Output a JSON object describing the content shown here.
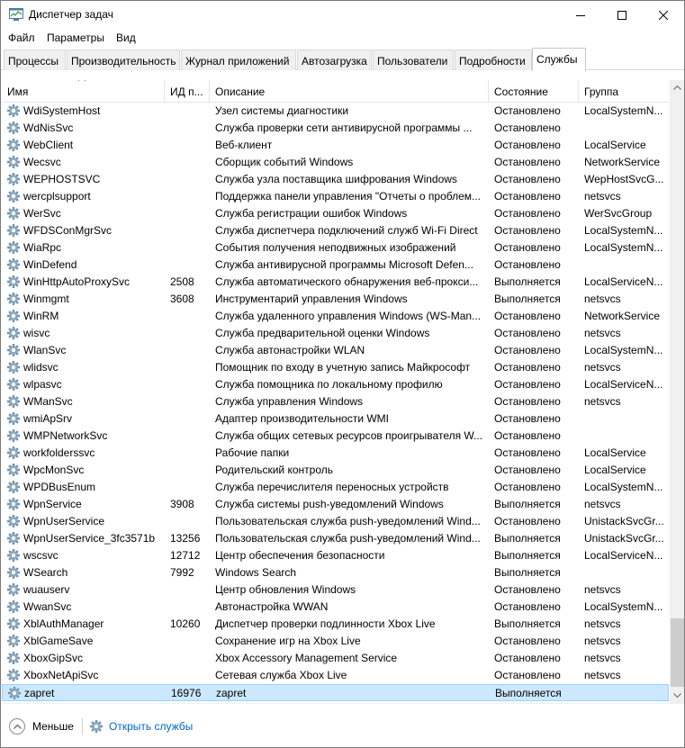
{
  "window": {
    "title": "Диспетчер задач"
  },
  "menu": [
    "Файл",
    "Параметры",
    "Вид"
  ],
  "tabs": [
    {
      "label": "Процессы"
    },
    {
      "label": "Производительность"
    },
    {
      "label": "Журнал приложений"
    },
    {
      "label": "Автозагрузка"
    },
    {
      "label": "Пользователи"
    },
    {
      "label": "Подробности"
    },
    {
      "label": "Службы",
      "active": true
    }
  ],
  "columns": {
    "name": "Имя",
    "pid": "ИД п...",
    "description": "Описание",
    "state": "Состояние",
    "group": "Группа"
  },
  "services": [
    {
      "name": "WdiSystemHost",
      "pid": "",
      "description": "Узел системы диагностики",
      "state": "Остановлено",
      "group": "LocalSystemN..."
    },
    {
      "name": "WdNisSvc",
      "pid": "",
      "description": "Служба проверки сети антивирусной программы ...",
      "state": "Остановлено",
      "group": ""
    },
    {
      "name": "WebClient",
      "pid": "",
      "description": "Веб-клиент",
      "state": "Остановлено",
      "group": "LocalService"
    },
    {
      "name": "Wecsvc",
      "pid": "",
      "description": "Сборщик событий Windows",
      "state": "Остановлено",
      "group": "NetworkService"
    },
    {
      "name": "WEPHOSTSVC",
      "pid": "",
      "description": "Служба узла поставщика шифрования Windows",
      "state": "Остановлено",
      "group": "WepHostSvcG..."
    },
    {
      "name": "wercplsupport",
      "pid": "",
      "description": "Поддержка панели управления \"Отчеты о проблем...",
      "state": "Остановлено",
      "group": "netsvcs"
    },
    {
      "name": "WerSvc",
      "pid": "",
      "description": "Служба регистрации ошибок Windows",
      "state": "Остановлено",
      "group": "WerSvcGroup"
    },
    {
      "name": "WFDSConMgrSvc",
      "pid": "",
      "description": "Служба диспетчера подключений служб Wi-Fi Direct",
      "state": "Остановлено",
      "group": "LocalSystemN..."
    },
    {
      "name": "WiaRpc",
      "pid": "",
      "description": "События получения неподвижных изображений",
      "state": "Остановлено",
      "group": "LocalSystemN..."
    },
    {
      "name": "WinDefend",
      "pid": "",
      "description": "Служба антивирусной программы Microsoft Defen...",
      "state": "Остановлено",
      "group": ""
    },
    {
      "name": "WinHttpAutoProxySvc",
      "pid": "2508",
      "description": "Служба автоматического обнаружения веб-прокси...",
      "state": "Выполняется",
      "group": "LocalServiceN..."
    },
    {
      "name": "Winmgmt",
      "pid": "3608",
      "description": "Инструментарий управления Windows",
      "state": "Выполняется",
      "group": "netsvcs"
    },
    {
      "name": "WinRM",
      "pid": "",
      "description": "Служба удаленного управления Windows (WS-Man...",
      "state": "Остановлено",
      "group": "NetworkService"
    },
    {
      "name": "wisvc",
      "pid": "",
      "description": "Служба предварительной оценки Windows",
      "state": "Остановлено",
      "group": "netsvcs"
    },
    {
      "name": "WlanSvc",
      "pid": "",
      "description": "Служба автонастройки WLAN",
      "state": "Остановлено",
      "group": "LocalSystemN..."
    },
    {
      "name": "wlidsvc",
      "pid": "",
      "description": "Помощник по входу в учетную запись Майкрософт",
      "state": "Остановлено",
      "group": "netsvcs"
    },
    {
      "name": "wlpasvc",
      "pid": "",
      "description": "Служба помощника по локальному профилю",
      "state": "Остановлено",
      "group": "LocalServiceN..."
    },
    {
      "name": "WManSvc",
      "pid": "",
      "description": "Служба управления Windows",
      "state": "Остановлено",
      "group": "netsvcs"
    },
    {
      "name": "wmiApSrv",
      "pid": "",
      "description": "Адаптер производительности WMI",
      "state": "Остановлено",
      "group": ""
    },
    {
      "name": "WMPNetworkSvc",
      "pid": "",
      "description": "Служба общих сетевых ресурсов проигрывателя W...",
      "state": "Остановлено",
      "group": ""
    },
    {
      "name": "workfolderssvc",
      "pid": "",
      "description": "Рабочие папки",
      "state": "Остановлено",
      "group": "LocalService"
    },
    {
      "name": "WpcMonSvc",
      "pid": "",
      "description": "Родительский контроль",
      "state": "Остановлено",
      "group": "LocalService"
    },
    {
      "name": "WPDBusEnum",
      "pid": "",
      "description": "Служба перечислителя переносных устройств",
      "state": "Остановлено",
      "group": "LocalSystemN..."
    },
    {
      "name": "WpnService",
      "pid": "3908",
      "description": "Служба системы push-уведомлений Windows",
      "state": "Выполняется",
      "group": "netsvcs"
    },
    {
      "name": "WpnUserService",
      "pid": "",
      "description": "Пользовательская служба push-уведомлений Wind...",
      "state": "Остановлено",
      "group": "UnistackSvcGr..."
    },
    {
      "name": "WpnUserService_3fc3571b",
      "pid": "13256",
      "description": "Пользовательская служба push-уведомлений Wind...",
      "state": "Выполняется",
      "group": "UnistackSvcGr..."
    },
    {
      "name": "wscsvc",
      "pid": "12712",
      "description": "Центр обеспечения безопасности",
      "state": "Выполняется",
      "group": "LocalServiceN..."
    },
    {
      "name": "WSearch",
      "pid": "7992",
      "description": "Windows Search",
      "state": "Выполняется",
      "group": ""
    },
    {
      "name": "wuauserv",
      "pid": "",
      "description": "Центр обновления Windows",
      "state": "Остановлено",
      "group": "netsvcs"
    },
    {
      "name": "WwanSvc",
      "pid": "",
      "description": "Автонастройка WWAN",
      "state": "Остановлено",
      "group": "LocalSystemN..."
    },
    {
      "name": "XblAuthManager",
      "pid": "10260",
      "description": "Диспетчер проверки подлинности Xbox Live",
      "state": "Выполняется",
      "group": "netsvcs"
    },
    {
      "name": "XblGameSave",
      "pid": "",
      "description": "Сохранение игр на Xbox Live",
      "state": "Остановлено",
      "group": "netsvcs"
    },
    {
      "name": "XboxGipSvc",
      "pid": "",
      "description": "Xbox Accessory Management Service",
      "state": "Остановлено",
      "group": "netsvcs"
    },
    {
      "name": "XboxNetApiSvc",
      "pid": "",
      "description": "Сетевая служба Xbox Live",
      "state": "Остановлено",
      "group": "netsvcs"
    },
    {
      "name": "zapret",
      "pid": "16976",
      "description": "zapret",
      "state": "Выполняется",
      "group": "",
      "selected": true
    }
  ],
  "footer": {
    "fewer_label": "Меньше",
    "open_services_label": "Открыть службы"
  },
  "colors": {
    "selection_bg": "#cce8ff",
    "selection_border": "#99d1ff",
    "link": "#0066cc",
    "gear_icon": "#6f8fa8"
  },
  "icons": {
    "app": "task-manager-icon",
    "service": "gear-icon",
    "fewer": "chevron-up-icon",
    "open_services": "gear-icon"
  }
}
